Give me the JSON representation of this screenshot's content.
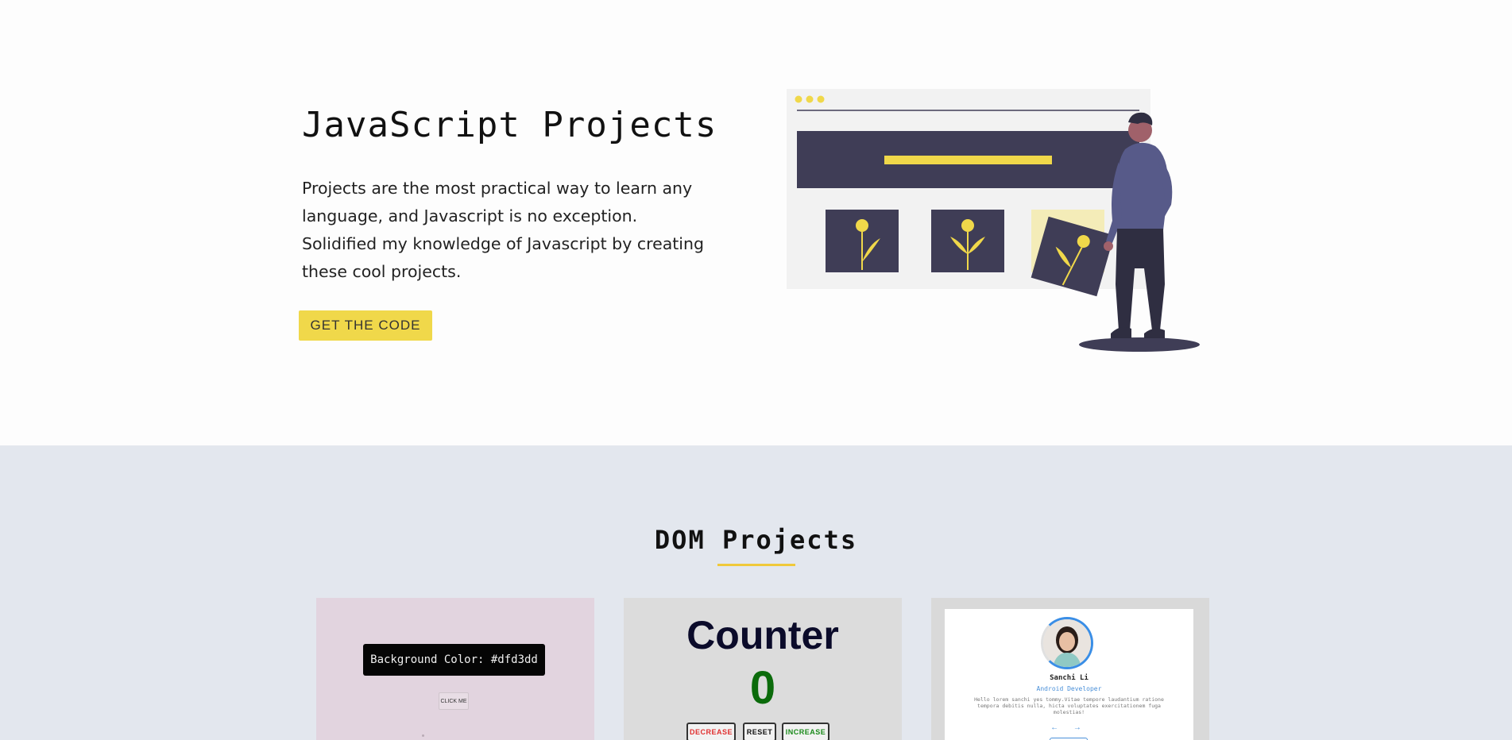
{
  "hero": {
    "title": "JavaScript Projects",
    "description": "Projects are the most practical way to learn any language, and Javascript is no exception. Solidified my knowledge of Javascript by creating these cool projects.",
    "cta_label": "GET THE CODE"
  },
  "dom_section": {
    "title": "DOM Projects",
    "cards": [
      {
        "name": "color-flipper",
        "label": "Background Color: #dfd3dd",
        "button_label": "CLICK ME"
      },
      {
        "name": "counter",
        "title": "Counter",
        "value": "0",
        "buttons": [
          "DECREASE",
          "RESET",
          "INCREASE"
        ]
      },
      {
        "name": "reviews",
        "person_name": "Sanchi Li",
        "job": "Android Developer",
        "text": "Hello lorem sanchi yes tommy.Vitae tempore laudantium ratione tempora debitis nulla, hicta voluptates exercitationem fuga molestias!",
        "arrows": "← →"
      }
    ]
  },
  "colors": {
    "accent": "#f0d84a",
    "section_bg": "#e3e7ee",
    "illustration_dark": "#3f3d56",
    "illustration_purple": "#575a89"
  }
}
